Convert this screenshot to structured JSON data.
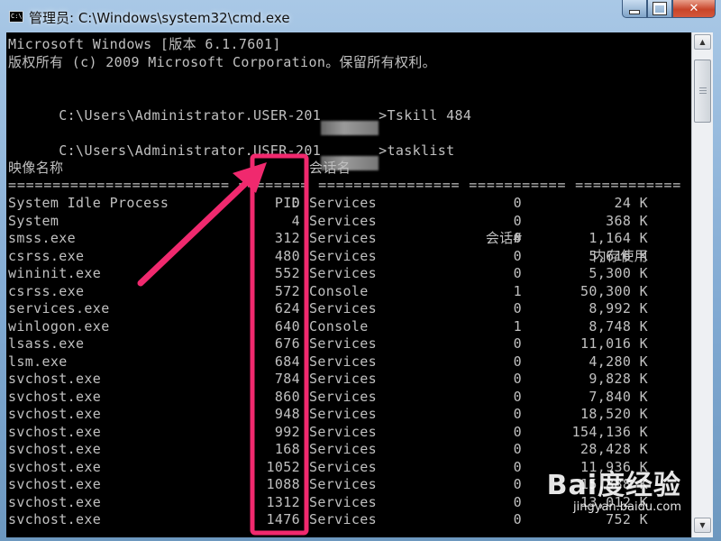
{
  "window": {
    "title": "管理员: C:\\Windows\\system32\\cmd.exe",
    "icon_glyph": "C:\\",
    "controls": {
      "minimize": "minimize-icon",
      "maximize": "maximize-icon",
      "close": "✕"
    }
  },
  "console": {
    "header_line1": "Microsoft Windows [版本 6.1.7601]",
    "header_line2": "版权所有 (c) 2009 Microsoft Corporation。保留所有权利。",
    "cmd1_prefix": "C:\\Users\\Administrator.USER-201",
    "cmd1_suffix": ">Tskill 484",
    "cmd2_prefix": "C:\\Users\\Administrator.USER-201",
    "cmd2_suffix": ">tasklist",
    "columns": {
      "image": "映像名称",
      "pid": "PID",
      "session": "会话名",
      "session_num": "会话#",
      "memory": "内存使用"
    },
    "separator": "========================= ======== ================ =========== ============",
    "rows": [
      {
        "name": "System Idle Process",
        "pid": "0",
        "session": "Services",
        "num": "0",
        "mem": "24 K"
      },
      {
        "name": "System",
        "pid": "4",
        "session": "Services",
        "num": "0",
        "mem": "368 K"
      },
      {
        "name": "smss.exe",
        "pid": "312",
        "session": "Services",
        "num": "0",
        "mem": "1,164 K"
      },
      {
        "name": "csrss.exe",
        "pid": "480",
        "session": "Services",
        "num": "0",
        "mem": "5,616 K"
      },
      {
        "name": "wininit.exe",
        "pid": "552",
        "session": "Services",
        "num": "0",
        "mem": "5,300 K"
      },
      {
        "name": "csrss.exe",
        "pid": "572",
        "session": "Console",
        "num": "1",
        "mem": "50,300 K"
      },
      {
        "name": "services.exe",
        "pid": "624",
        "session": "Services",
        "num": "0",
        "mem": "8,992 K"
      },
      {
        "name": "winlogon.exe",
        "pid": "640",
        "session": "Console",
        "num": "1",
        "mem": "8,748 K"
      },
      {
        "name": "lsass.exe",
        "pid": "676",
        "session": "Services",
        "num": "0",
        "mem": "11,016 K"
      },
      {
        "name": "lsm.exe",
        "pid": "684",
        "session": "Services",
        "num": "0",
        "mem": "4,280 K"
      },
      {
        "name": "svchost.exe",
        "pid": "784",
        "session": "Services",
        "num": "0",
        "mem": "9,828 K"
      },
      {
        "name": "svchost.exe",
        "pid": "860",
        "session": "Services",
        "num": "0",
        "mem": "7,840 K"
      },
      {
        "name": "svchost.exe",
        "pid": "948",
        "session": "Services",
        "num": "0",
        "mem": "18,520 K"
      },
      {
        "name": "svchost.exe",
        "pid": "992",
        "session": "Services",
        "num": "0",
        "mem": "154,136 K"
      },
      {
        "name": "svchost.exe",
        "pid": "168",
        "session": "Services",
        "num": "0",
        "mem": "28,428 K"
      },
      {
        "name": "svchost.exe",
        "pid": "1052",
        "session": "Services",
        "num": "0",
        "mem": "11,936 K"
      },
      {
        "name": "svchost.exe",
        "pid": "1088",
        "session": "Services",
        "num": "0",
        "mem": "15,888 K"
      },
      {
        "name": "svchost.exe",
        "pid": "1312",
        "session": "Services",
        "num": "0",
        "mem": "13,012 K"
      },
      {
        "name": "svchost.exe",
        "pid": "1476",
        "session": "Services",
        "num": "0",
        "mem": "752 K"
      }
    ]
  },
  "annotation": {
    "color": "#f0296e"
  },
  "watermark": {
    "logo": "Bai度经验",
    "url": "jingyan.baidu.com"
  }
}
